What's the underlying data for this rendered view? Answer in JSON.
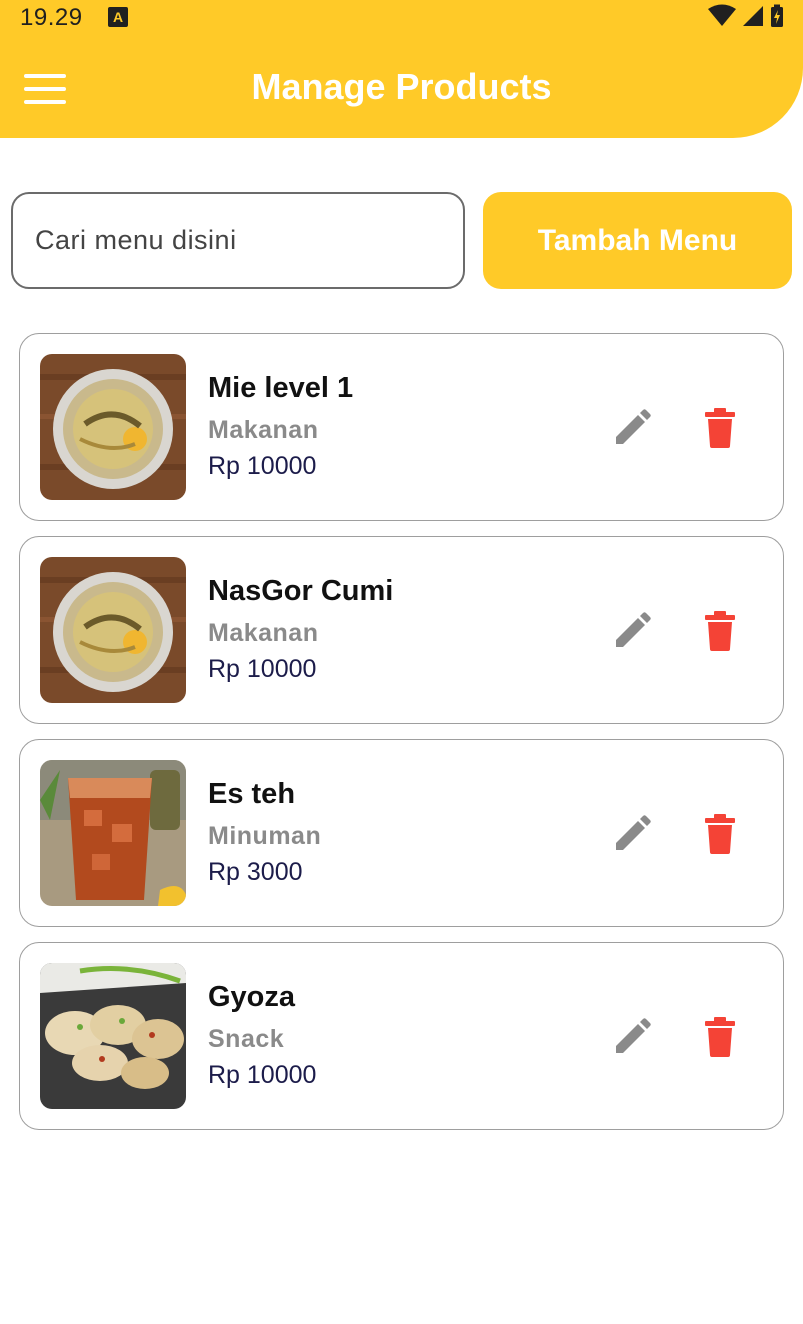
{
  "status_bar": {
    "time": "19.29",
    "notification_badge": "A",
    "icons": [
      "wifi-icon",
      "signal-icon",
      "battery-icon"
    ]
  },
  "header": {
    "title": "Manage Products",
    "menu_icon": "hamburger-icon"
  },
  "search": {
    "placeholder": "Cari menu disini",
    "value": ""
  },
  "add_button": {
    "label": "Tambah Menu"
  },
  "products": [
    {
      "name": "Mie level 1",
      "category": "Makanan",
      "price": "Rp 10000",
      "image": "noodle-dish"
    },
    {
      "name": "NasGor Cumi",
      "category": "Makanan",
      "price": "Rp 10000",
      "image": "noodle-dish"
    },
    {
      "name": "Es teh",
      "category": "Minuman",
      "price": "Rp 3000",
      "image": "iced-tea"
    },
    {
      "name": "Gyoza",
      "category": "Snack",
      "price": "Rp 10000",
      "image": "gyoza"
    }
  ],
  "colors": {
    "primary": "#FFCA28",
    "edit_icon": "#8a8a8a",
    "delete_icon": "#F44336",
    "price_text": "#1c1c4a",
    "category_text": "#8a8a8a"
  }
}
